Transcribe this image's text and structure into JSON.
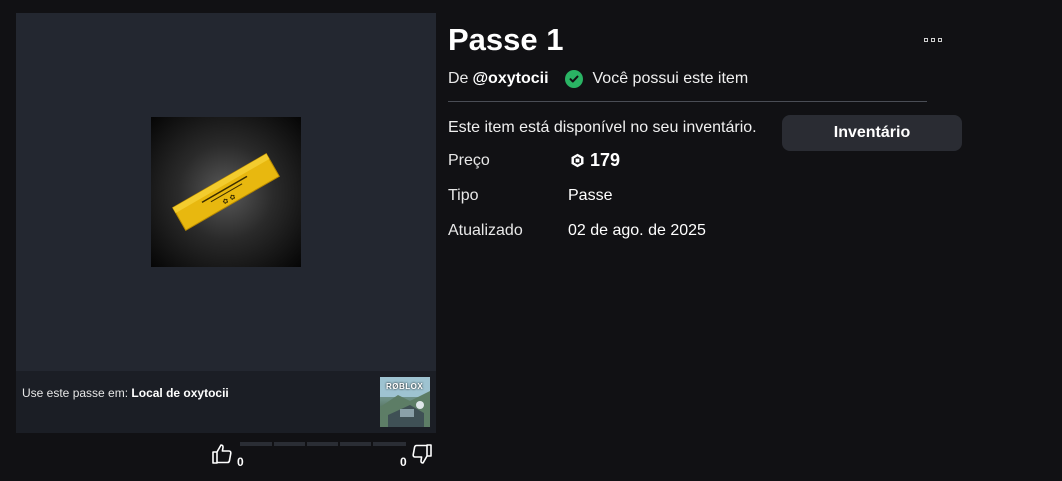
{
  "item": {
    "title": "Passe 1",
    "by_prefix": "De",
    "creator": "@oxytocii",
    "owned_text": "Você possui este item",
    "availability": "Este item está disponível no seu inventário.",
    "inventory_button": "Inventário"
  },
  "details": {
    "price_label": "Preço",
    "price_value": "179",
    "type_label": "Tipo",
    "type_value": "Passe",
    "updated_label": "Atualizado",
    "updated_value": "02 de ago. de 2025"
  },
  "place": {
    "prefix": "Use este passe em:",
    "name": "Local de oxytocii",
    "thumbnail_logo": "RØBLOX"
  },
  "votes": {
    "up_count": "0",
    "down_count": "0"
  },
  "icons": {
    "owned": "check-circle-icon",
    "price": "robux-icon",
    "menu": "more-options-icon",
    "upvote": "thumbs-up-icon",
    "downvote": "thumbs-down-icon"
  },
  "colors": {
    "background": "#111114",
    "panel": "#232730",
    "owned_green": "#2ab464",
    "button": "#2a2c33",
    "pass_gold": "#e8b80f"
  }
}
